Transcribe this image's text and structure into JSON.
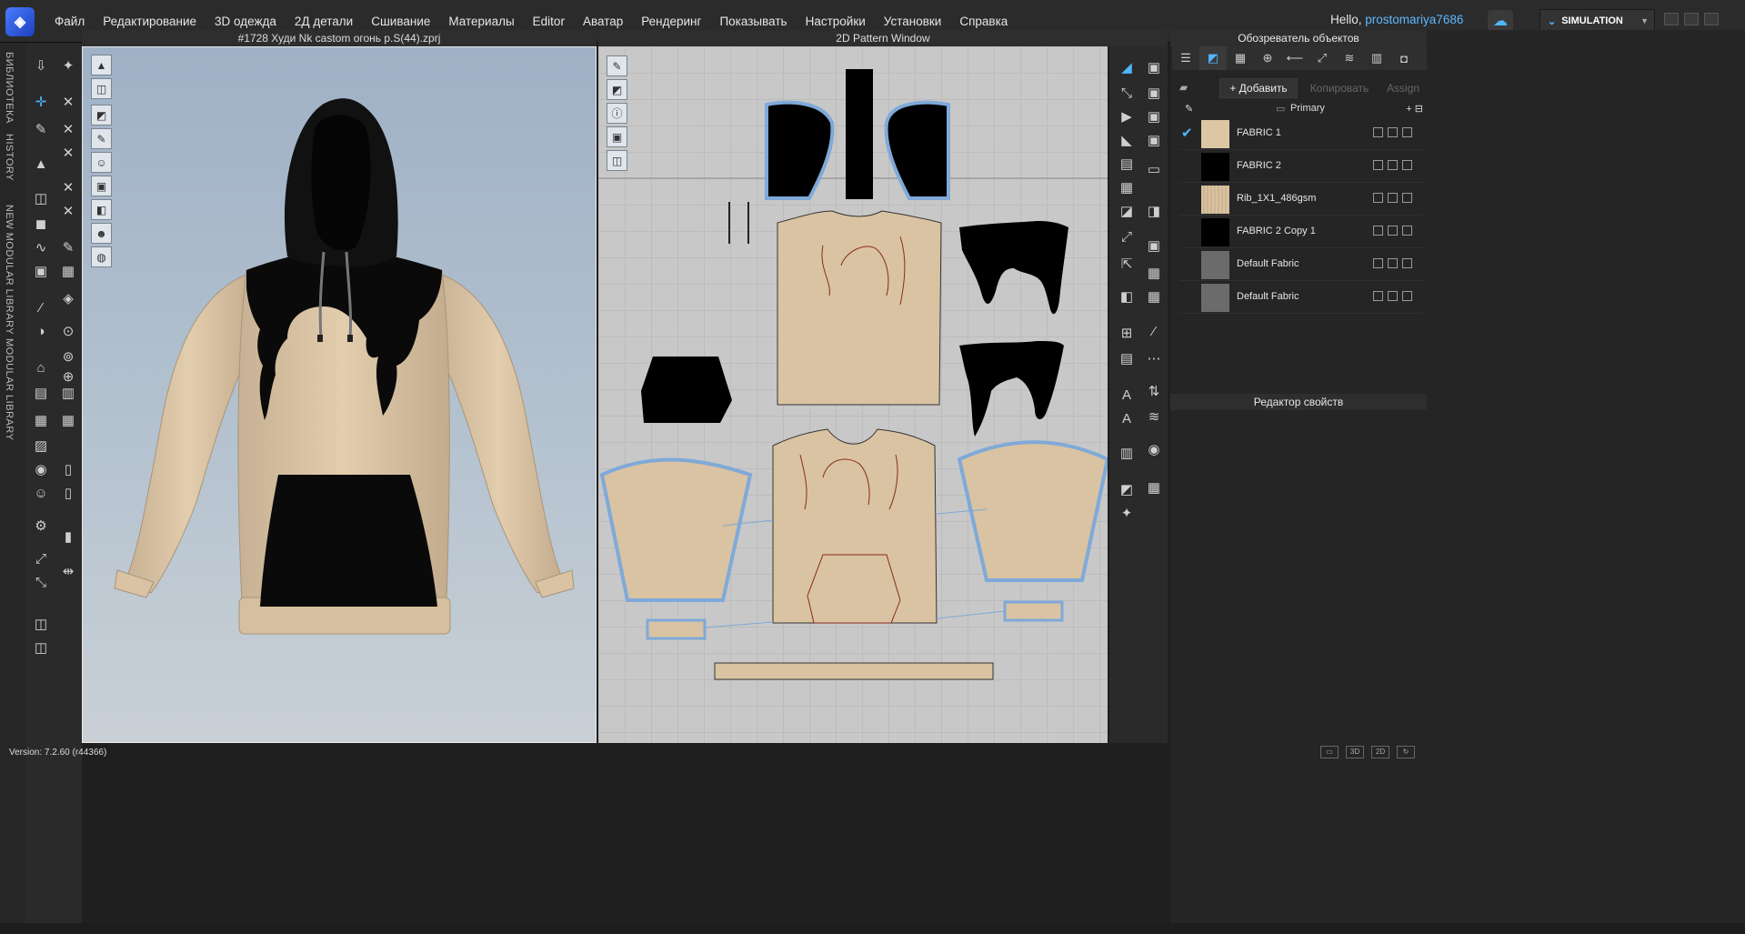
{
  "app": {
    "logo_icon": "clo3d-logo-icon",
    "version": "Version: 7.2.60 (r44366)"
  },
  "menu": [
    "Файл",
    "Редактирование",
    "3D одежда",
    "2Д детали",
    "Сшивание",
    "Материалы",
    "Editor",
    "Аватар",
    "Рендеринг",
    "Показывать",
    "Настройки",
    "Установки",
    "Справка"
  ],
  "user": {
    "greeting": "Hello,",
    "name": "prostomariya7686"
  },
  "mode": {
    "label": "SIMULATION"
  },
  "left_tabs": [
    "БИБЛИОТЕКА",
    "HISTORY",
    "NEW MODULAR LIBRARY",
    "MODULAR LIBRARY"
  ],
  "viewport3d": {
    "title": "#1728 Худи Nk castom огонь p.S(44).zprj"
  },
  "viewport2d": {
    "title": "2D Pattern Window"
  },
  "object_browser": {
    "title": "Обозреватель объектов",
    "add_label": "+ Добавить",
    "copy_label": "Копировать",
    "assign_label": "Assign",
    "colorway": "Primary",
    "fabrics": [
      {
        "name": "FABRIC 1",
        "color": "#dcc6a4",
        "selected": true
      },
      {
        "name": "FABRIC 2",
        "color": "#000000",
        "selected": false
      },
      {
        "name": "Rib_1X1_486gsm",
        "color": "#d9c2a0",
        "selected": false
      },
      {
        "name": "FABRIC 2 Copy 1",
        "color": "#000000",
        "selected": false
      },
      {
        "name": "Default Fabric",
        "color": "#6b6b6b",
        "selected": false
      },
      {
        "name": "Default Fabric",
        "color": "#6b6b6b",
        "selected": false
      }
    ]
  },
  "property_editor": {
    "title": "Редактор свойств"
  },
  "colors": {
    "beige": "#d9c3a2",
    "black": "#0a0a0a",
    "accent": "#4fb7ff",
    "outline_blue": "#7fa9d8",
    "seam_red": "#8a2a1e"
  }
}
